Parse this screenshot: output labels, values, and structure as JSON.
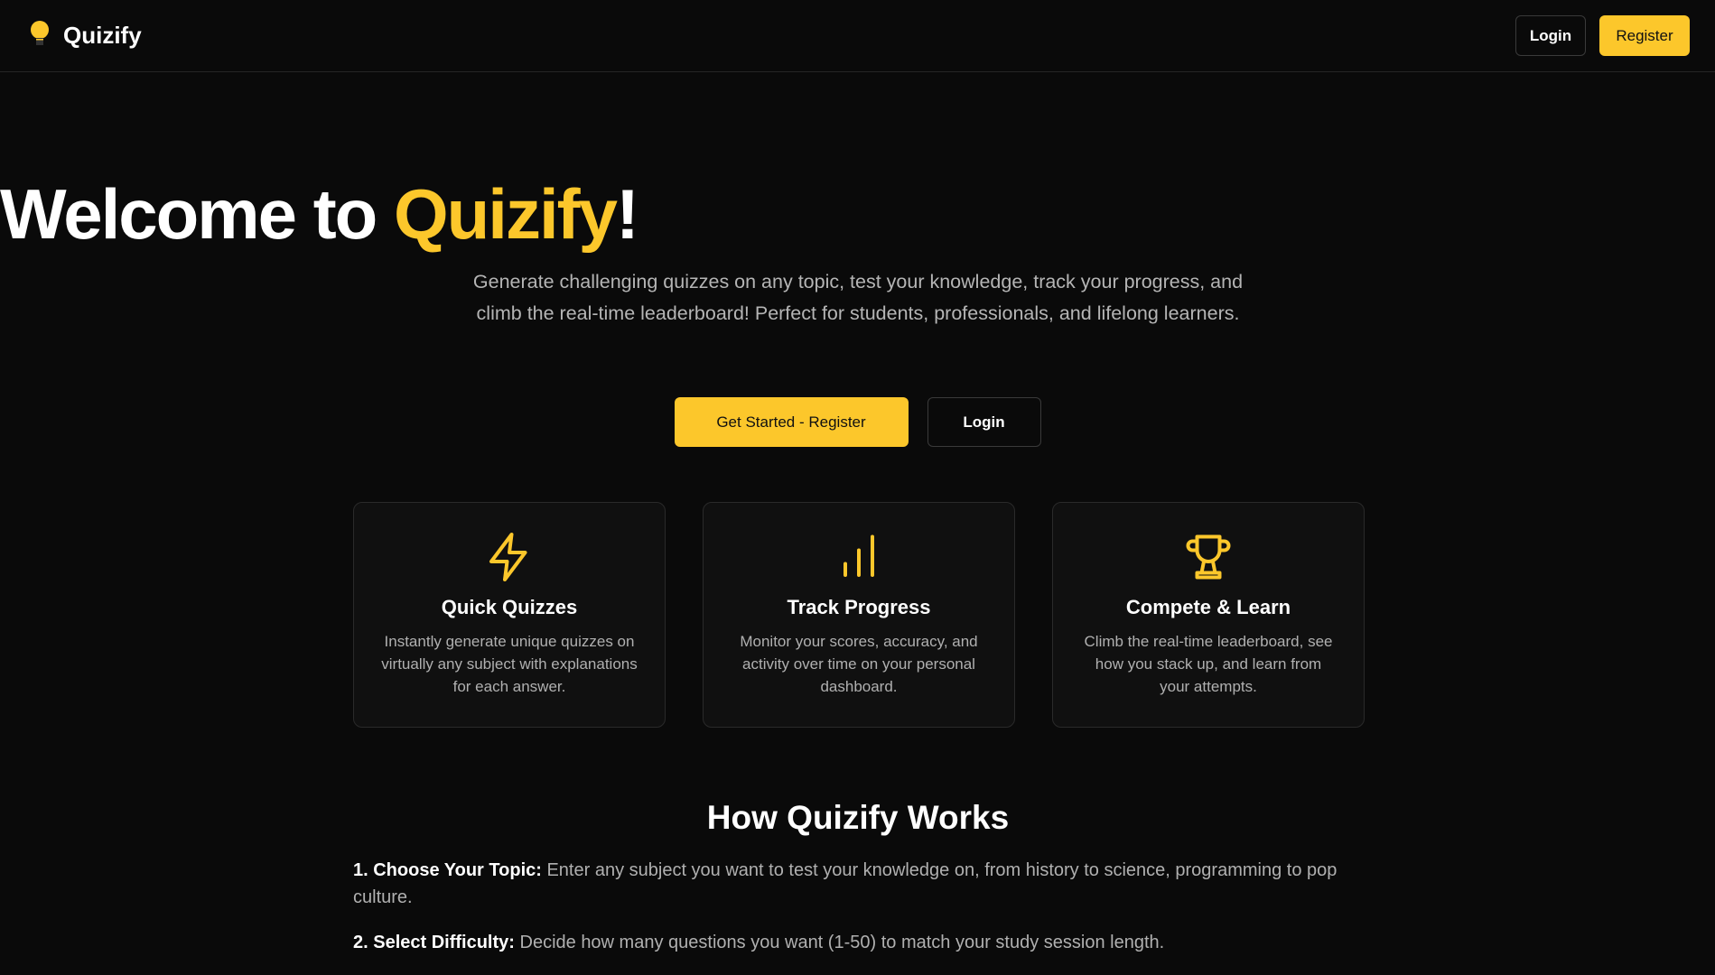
{
  "header": {
    "brand": "Quizify",
    "login": "Login",
    "register": "Register"
  },
  "hero": {
    "title_prefix": "Welcome to ",
    "title_accent": "Quizify",
    "title_suffix": "!",
    "subtitle": "Generate challenging quizzes on any topic, test your knowledge, track your progress, and climb the real-time leaderboard! Perfect for students, professionals, and lifelong learners.",
    "primary_cta": "Get Started - Register",
    "secondary_cta": "Login"
  },
  "features": [
    {
      "icon": "lightning-icon",
      "title": "Quick Quizzes",
      "desc": "Instantly generate unique quizzes on virtually any subject with explanations for each answer."
    },
    {
      "icon": "bar-chart-icon",
      "title": "Track Progress",
      "desc": "Monitor your scores, accuracy, and activity over time on your personal dashboard."
    },
    {
      "icon": "trophy-icon",
      "title": "Compete & Learn",
      "desc": "Climb the real-time leaderboard, see how you stack up, and learn from your attempts."
    }
  ],
  "how": {
    "title": "How Quizify Works",
    "steps": [
      {
        "label": "1. Choose Your Topic:",
        "text": "Enter any subject you want to test your knowledge on, from history to science, programming to pop culture."
      },
      {
        "label": "2. Select Difficulty:",
        "text": "Decide how many questions you want (1-50) to match your study session length."
      }
    ]
  },
  "colors": {
    "accent": "#fcc72b",
    "background": "#0a0a0a"
  }
}
